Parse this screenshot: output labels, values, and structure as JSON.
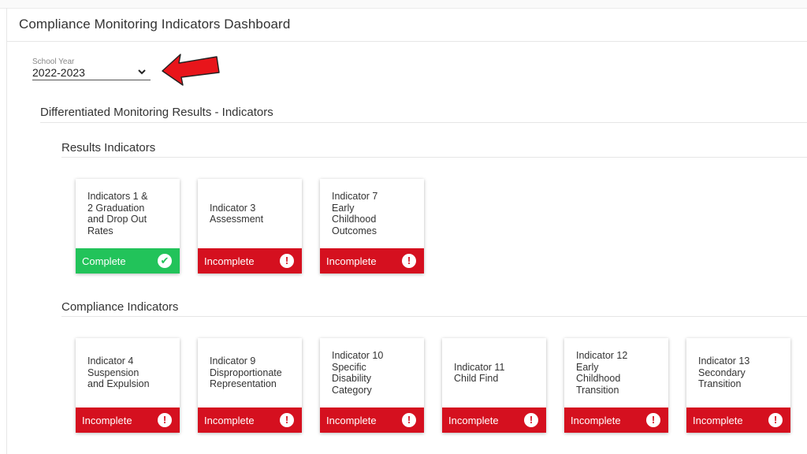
{
  "page": {
    "title": "Compliance Monitoring Indicators Dashboard"
  },
  "filter": {
    "label": "School Year",
    "value": "2022-2023"
  },
  "sections": {
    "monitoring": "Differentiated Monitoring Results - Indicators",
    "results": "Results Indicators",
    "compliance": "Compliance Indicators"
  },
  "results_cards": [
    {
      "name": "Indicators 1 &\n2 Graduation\nand Drop Out\nRates",
      "status": "Complete",
      "state": "complete",
      "icon": "check-circle-icon"
    },
    {
      "name": "Indicator 3\nAssessment",
      "status": "Incomplete",
      "state": "incomplete",
      "icon": "exclamation-circle-icon"
    },
    {
      "name": "Indicator 7\nEarly\nChildhood\nOutcomes",
      "status": "Incomplete",
      "state": "incomplete",
      "icon": "exclamation-circle-icon"
    }
  ],
  "compliance_cards": [
    {
      "name": "Indicator 4\nSuspension\nand Expulsion",
      "status": "Incomplete",
      "state": "incomplete",
      "icon": "exclamation-circle-icon"
    },
    {
      "name": "Indicator 9\nDisproportionate\nRepresentation",
      "status": "Incomplete",
      "state": "incomplete",
      "icon": "exclamation-circle-icon"
    },
    {
      "name": "Indicator 10\nSpecific\nDisability\nCategory",
      "status": "Incomplete",
      "state": "incomplete",
      "icon": "exclamation-circle-icon"
    },
    {
      "name": "Indicator 11\nChild Find",
      "status": "Incomplete",
      "state": "incomplete",
      "icon": "exclamation-circle-icon"
    },
    {
      "name": "Indicator 12\nEarly\nChildhood\nTransition",
      "status": "Incomplete",
      "state": "incomplete",
      "icon": "exclamation-circle-icon"
    },
    {
      "name": "Indicator 13\nSecondary\nTransition",
      "status": "Incomplete",
      "state": "incomplete",
      "icon": "exclamation-circle-icon"
    }
  ],
  "colors": {
    "complete": "#22c35a",
    "incomplete": "#d5101f",
    "annotation_arrow": "#e8151b"
  }
}
